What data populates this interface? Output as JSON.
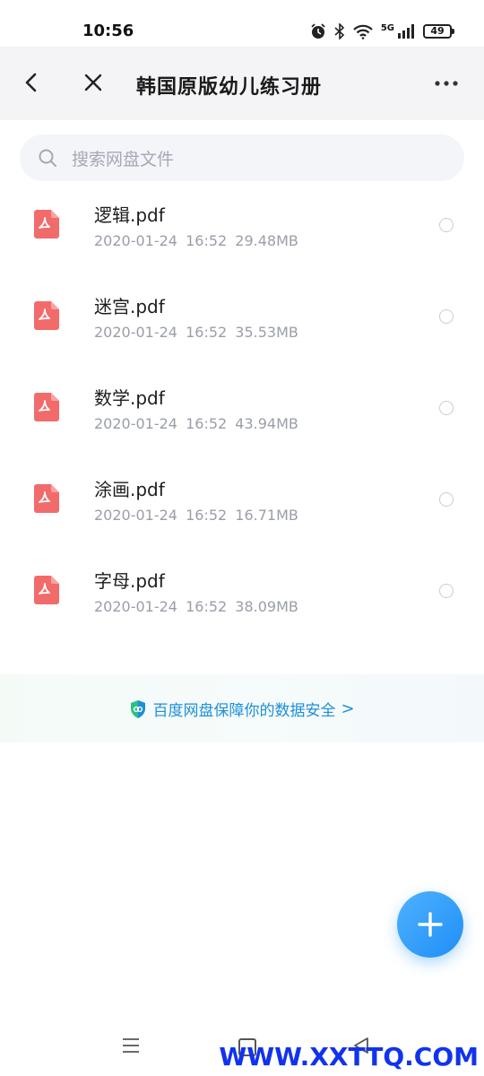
{
  "status_bar": {
    "time": "10:56",
    "battery": "49",
    "network": "5G",
    "icons": [
      "alarm-icon",
      "bluetooth-icon",
      "wifi-icon",
      "signal-icon",
      "battery-icon"
    ]
  },
  "header": {
    "title": "韩国原版幼儿练习册",
    "back_icon": "chevron-left-icon",
    "close_icon": "close-icon",
    "more_icon": "more-horizontal-icon"
  },
  "search": {
    "placeholder": "搜索网盘文件"
  },
  "files": [
    {
      "name": "逻辑.pdf",
      "date": "2020-01-24",
      "time": "16:52",
      "size": "29.48MB"
    },
    {
      "name": "迷宫.pdf",
      "date": "2020-01-24",
      "time": "16:52",
      "size": "35.53MB"
    },
    {
      "name": "数学.pdf",
      "date": "2020-01-24",
      "time": "16:52",
      "size": "43.94MB"
    },
    {
      "name": "涂画.pdf",
      "date": "2020-01-24",
      "time": "16:52",
      "size": "16.71MB"
    },
    {
      "name": "字母.pdf",
      "date": "2020-01-24",
      "time": "16:52",
      "size": "38.09MB"
    }
  ],
  "banner": {
    "text": "百度网盘保障你的数据安全",
    "arrow": ">"
  },
  "fab": {
    "icon": "plus-icon"
  },
  "nav": {
    "icons": [
      "menu-icon",
      "home-icon",
      "back-triangle-icon"
    ]
  },
  "watermark": "WWW.XXTTQ.COM",
  "colors": {
    "accent": "#1f8ef5",
    "pdf_red": "#f26b6b",
    "header_bg": "#f4f4f6",
    "meta_text": "#9a9ea8"
  }
}
